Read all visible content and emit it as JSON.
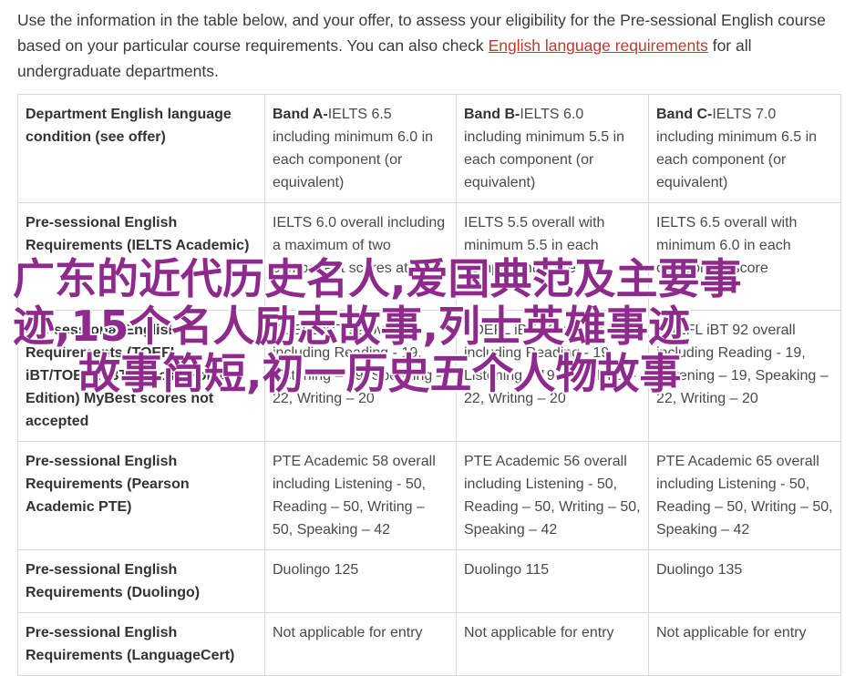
{
  "intro": {
    "text_before": "Use the information in the table below, and your offer, to assess your eligibility for the Pre-sessional English course based on your particular course requirements. You can also check ",
    "link": "English language requirements",
    "text_after": " for all undergraduate departments."
  },
  "table": {
    "header": {
      "label": "Department English language condition (see offer)",
      "bands": [
        {
          "band": "Band A-",
          "text": "IELTS 6.5 including minimum 6.0 in each component (or equivalent)"
        },
        {
          "band": "Band B-",
          "text": "IELTS 6.0 including minimum 5.5 in each component (or equivalent)"
        },
        {
          "band": "Band C-",
          "text": "IELTS 7.0 including minimum 6.5 in each component (or equivalent)"
        }
      ]
    },
    "rows": [
      {
        "label": "Pre-sessional English Requirements (IELTS Academic)",
        "cells": [
          "IELTS 6.0 overall including a maximum of two component scores at 5.5",
          "IELTS 5.5 overall with minimum 5.5 in each component score",
          "IELTS 6.5 overall with minimum 6.0 in each component score"
        ]
      },
      {
        "label": "Pre-sessional English Requirements (TOEFL iBT/TOEFL iBT Special Home Edition) MyBest scores not accepted",
        "cells": [
          "TOEFL iBT 92 overall including Reading - 19, Listening – 19, Speaking – 22, Writing – 20",
          "TOEFL iBT 82 overall including Reading - 19, Listening – 19, Speaking – 22, Writing – 20",
          "TOEFL iBT 92 overall including Reading - 19, Listening – 19, Speaking – 22, Writing – 20"
        ]
      },
      {
        "label": "Pre-sessional English Requirements (Pearson Academic PTE)",
        "cells": [
          "PTE Academic 58 overall including Listening - 50, Reading – 50, Writing – 50, Speaking – 42",
          "PTE Academic 56 overall including Listening - 50, Reading – 50, Writing – 50, Speaking – 42",
          "PTE Academic 65 overall including Listening - 50, Reading – 50, Writing – 50, Speaking – 42"
        ]
      },
      {
        "label": "Pre-sessional English Requirements (Duolingo)",
        "cells": [
          "Duolingo 125",
          "Duolingo 115",
          "Duolingo 135"
        ]
      },
      {
        "label": "Pre-sessional English Requirements (LanguageCert)",
        "cells": [
          "Not applicable for entry",
          "Not applicable for entry",
          "Not applicable for entry"
        ]
      }
    ]
  },
  "overlay": {
    "line1": "广东的近代历史名人,爱国典范及主要事",
    "line2": "迹,15个名人励志故事,列士英雄事迹",
    "line3": "故事简短,初一历史五个人物故事"
  },
  "colors": {
    "link": "#c0392b",
    "overlay_text": "#8e2a8c",
    "border": "#d8d8d8"
  }
}
